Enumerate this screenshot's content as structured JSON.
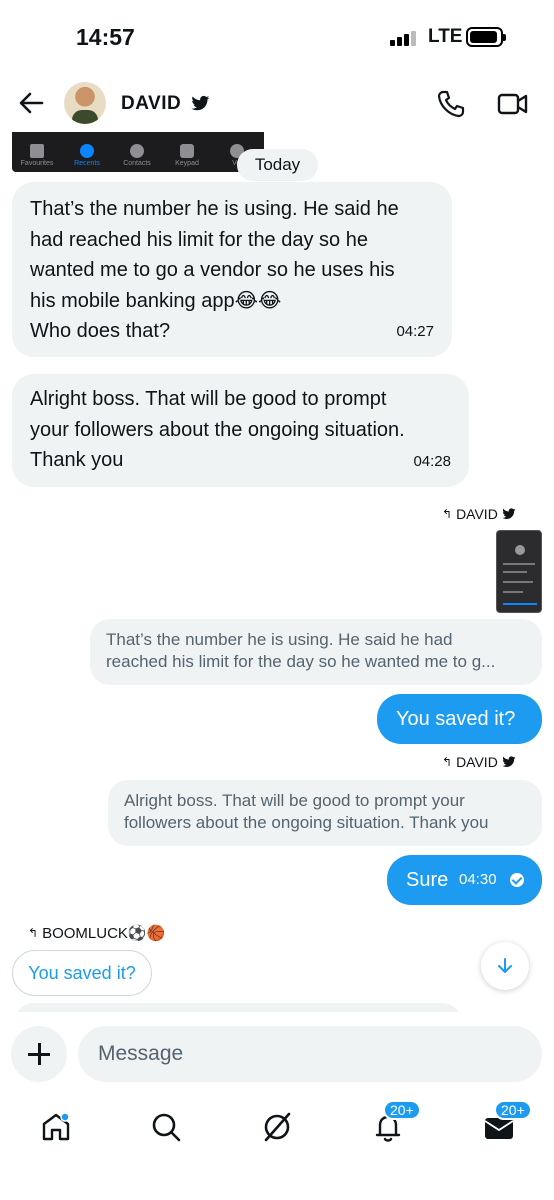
{
  "status_bar": {
    "time": "14:57",
    "network": "LTE"
  },
  "header": {
    "contact_name": "DAVID"
  },
  "phone_strip": {
    "tabs": [
      "Favourites",
      "Recents",
      "Contacts",
      "Keypad",
      "Voi"
    ]
  },
  "date_separator": "Today",
  "messages": {
    "in1": {
      "lines": [
        "That’s the number he is using. He said he",
        "had reached his limit for the day so he",
        "wanted me to go a vendor so he uses his",
        "his mobile banking app😂😂",
        "Who does that?"
      ],
      "time": "04:27"
    },
    "in2": {
      "lines": [
        "Alright boss. That will be good to prompt",
        "your followers about the ongoing situation.",
        "Thank you"
      ],
      "time": "04:28"
    },
    "reply_label_1": "DAVID",
    "quote1": {
      "lines": [
        "That’s the number he is using. He said he had",
        "reached his limit for the day so he wanted me to g..."
      ]
    },
    "out1": {
      "text": "You saved it?"
    },
    "reply_label_2": "DAVID",
    "quote2": {
      "lines": [
        "Alright boss. That will be good to prompt your",
        "followers about the ongoing situation. Thank you"
      ]
    },
    "out2": {
      "text": "Sure",
      "time": "04:30"
    },
    "reply_label_3": "BOOMLUCK⚽️🏀",
    "suggestion": "You saved it?"
  },
  "composer": {
    "placeholder": "Message"
  },
  "bottom_nav": {
    "notifications_badge": "20+",
    "messages_badge": "20+"
  },
  "colors": {
    "accent": "#1d9bf0",
    "bubble_in": "#eff3f4",
    "text": "#0f1419",
    "muted": "#536471"
  }
}
